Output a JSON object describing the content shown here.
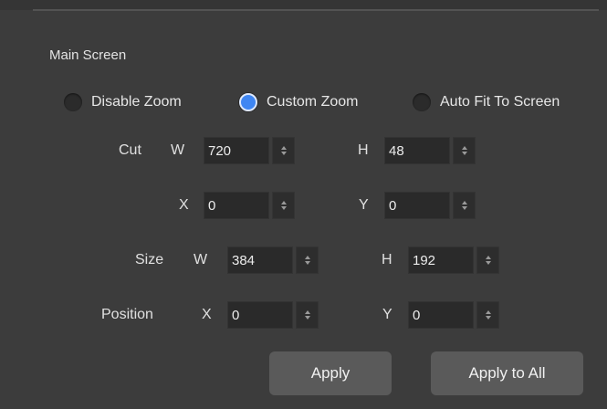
{
  "section": {
    "title": "Main Screen"
  },
  "zoom_modes": [
    {
      "label": "Disable Zoom",
      "checked": false
    },
    {
      "label": "Custom Zoom",
      "checked": true
    },
    {
      "label": "Auto Fit To Screen",
      "checked": false
    }
  ],
  "cut": {
    "label": "Cut",
    "w_label": "W",
    "w": "720",
    "h_label": "H",
    "h": "48",
    "x_label": "X",
    "x": "0",
    "y_label": "Y",
    "y": "0"
  },
  "size": {
    "label": "Size",
    "w_label": "W",
    "w": "384",
    "h_label": "H",
    "h": "192"
  },
  "position": {
    "label": "Position",
    "x_label": "X",
    "x": "0",
    "y_label": "Y",
    "y": "0"
  },
  "buttons": {
    "apply": "Apply",
    "apply_all": "Apply to All"
  },
  "colors": {
    "background": "#3c3c3c",
    "accent": "#3f86f2",
    "field": "#2a2a2a",
    "button": "#5a5a5a"
  }
}
